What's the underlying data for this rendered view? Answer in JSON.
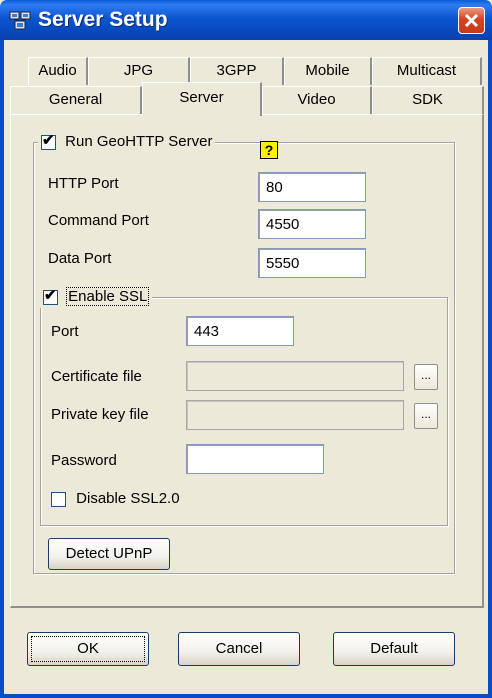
{
  "window": {
    "title": "Server Setup",
    "app_icon": "network-computers-icon",
    "close_icon": "close-icon"
  },
  "tabs": {
    "row1": [
      "Audio",
      "JPG",
      "3GPP",
      "Mobile",
      "Multicast"
    ],
    "row2": [
      "General",
      "Server",
      "Video",
      "SDK"
    ],
    "active": "Server"
  },
  "server": {
    "run_label": "Run GeoHTTP Server",
    "run_checked": true,
    "help_glyph": "?",
    "http_port_label": "HTTP Port",
    "http_port_value": "80",
    "command_port_label": "Command Port",
    "command_port_value": "4550",
    "data_port_label": "Data Port",
    "data_port_value": "5550"
  },
  "ssl": {
    "enable_label": "Enable SSL",
    "enable_checked": true,
    "port_label": "Port",
    "port_value": "443",
    "cert_label": "Certificate file",
    "cert_value": "",
    "key_label": "Private key file",
    "key_value": "",
    "browse_label": "...",
    "password_label": "Password",
    "password_value": "",
    "disable_ssl2_label": "Disable SSL2.0",
    "disable_ssl2_checked": false
  },
  "detect_upnp_label": "Detect UPnP",
  "buttons": {
    "ok": "OK",
    "cancel": "Cancel",
    "default": "Default"
  }
}
